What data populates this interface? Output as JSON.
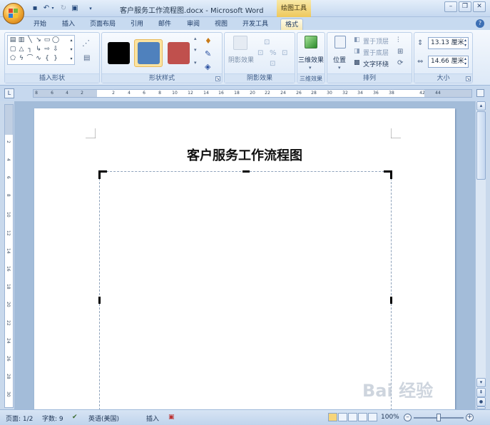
{
  "window": {
    "title": "客户服务工作流程图.docx - Microsoft Word",
    "context_tab_title": "绘图工具"
  },
  "tabs": [
    "开始",
    "插入",
    "页面布局",
    "引用",
    "邮件",
    "审阅",
    "视图",
    "开发工具",
    "格式"
  ],
  "active_tab": "格式",
  "ribbon": {
    "groups": {
      "insert_shapes": "插入形状",
      "shape_styles": "形状样式",
      "shadow_effects": "阴影效果",
      "threed_effects": "三维效果",
      "arrange": "排列",
      "size": "大小"
    },
    "shadow_effects_button": "阴影效果",
    "threed_effects_button": "三维效果",
    "position_button": "位置",
    "bring_to_front": "置于顶层",
    "send_to_back": "置于底层",
    "text_wrapping": "文字环绕",
    "height_value": "13.13 厘米",
    "width_value": "14.66 厘米",
    "style_colors": [
      "#000000",
      "#4f81bd",
      "#c0504d"
    ]
  },
  "ruler": {
    "h_ticks": [
      "8",
      "6",
      "4",
      "2",
      "2",
      "4",
      "6",
      "8",
      "10",
      "12",
      "14",
      "16",
      "18",
      "20",
      "22",
      "24",
      "26",
      "28",
      "30",
      "32",
      "34",
      "36",
      "38",
      "42",
      "44"
    ],
    "v_ticks": [
      "2",
      "4",
      "6",
      "8",
      "10",
      "12",
      "14",
      "16",
      "18",
      "20",
      "22",
      "24",
      "26",
      "28",
      "30"
    ]
  },
  "document": {
    "heading": "客户服务工作流程图"
  },
  "status": {
    "page": "页面: 1/2",
    "words": "字数: 9",
    "language": "英语(美国)",
    "mode": "插入",
    "zoom": "100%"
  },
  "watermark": "Bai 经验"
}
